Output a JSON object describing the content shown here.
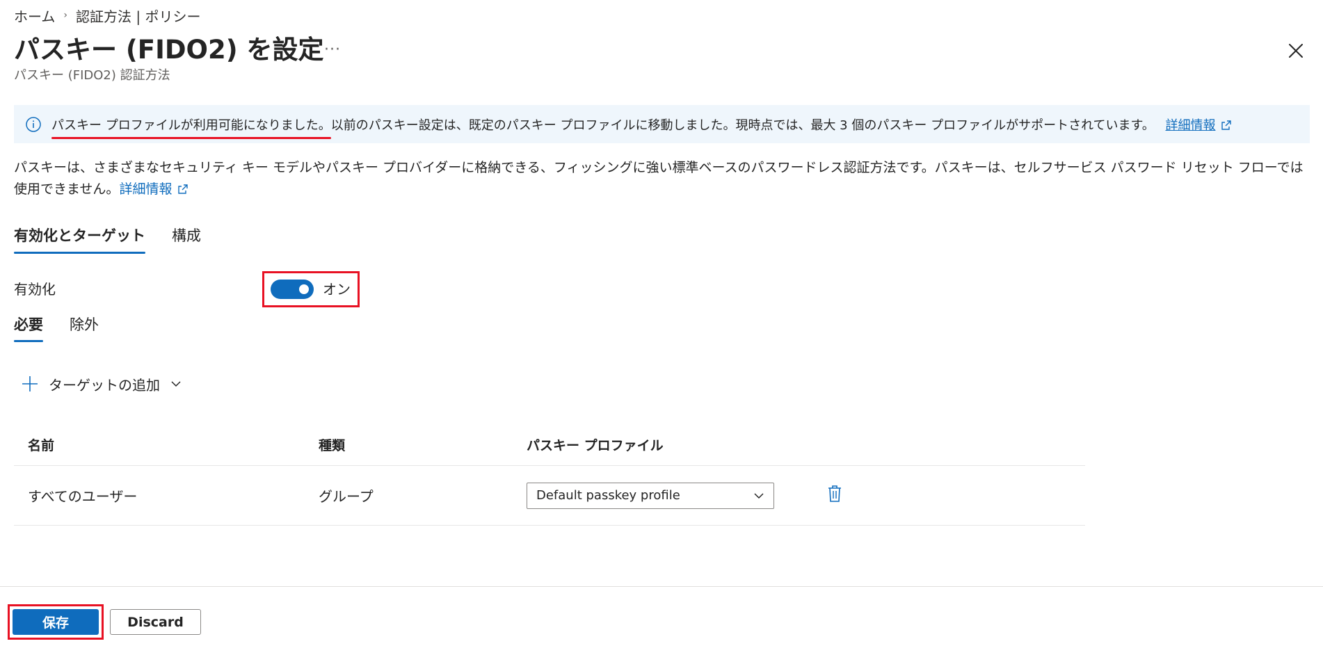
{
  "breadcrumb": {
    "home": "ホーム",
    "current": "認証方法 | ポリシー"
  },
  "header": {
    "title": "パスキー (FIDO2) を設定",
    "more": "···",
    "subtitle": "パスキー (FIDO2) 認証方法"
  },
  "banner": {
    "highlight": "パスキー プロファイルが利用可能になりました。",
    "text": "以前のパスキー設定は、既定のパスキー プロファイルに移動しました。現時点では、最大 3 個のパスキー プロファイルがサポートされています。",
    "link": "詳細情報"
  },
  "description": {
    "text": "パスキーは、さまざまなセキュリティ キー モデルやパスキー プロバイダーに格納できる、フィッシングに強い標準ベースのパスワードレス認証方法です。パスキーは、セルフサービス パスワード リセット フローでは使用できません。",
    "link": "詳細情報"
  },
  "tabs": [
    {
      "label": "有効化とターゲット",
      "active": true
    },
    {
      "label": "構成",
      "active": false
    }
  ],
  "enable": {
    "label": "有効化",
    "state": "オン",
    "on": true
  },
  "subtabs": [
    {
      "label": "必要",
      "active": true
    },
    {
      "label": "除外",
      "active": false
    }
  ],
  "add_target": {
    "label": "ターゲットの追加"
  },
  "table": {
    "headers": [
      "名前",
      "種類",
      "パスキー プロファイル"
    ],
    "rows": [
      {
        "name": "すべてのユーザー",
        "type": "グループ",
        "profile": "Default passkey profile"
      }
    ]
  },
  "footer": {
    "save": "保存",
    "discard": "Discard"
  },
  "colors": {
    "accent": "#0f6cbd",
    "highlight_red": "#e81123",
    "banner_bg": "#eff6fc"
  }
}
